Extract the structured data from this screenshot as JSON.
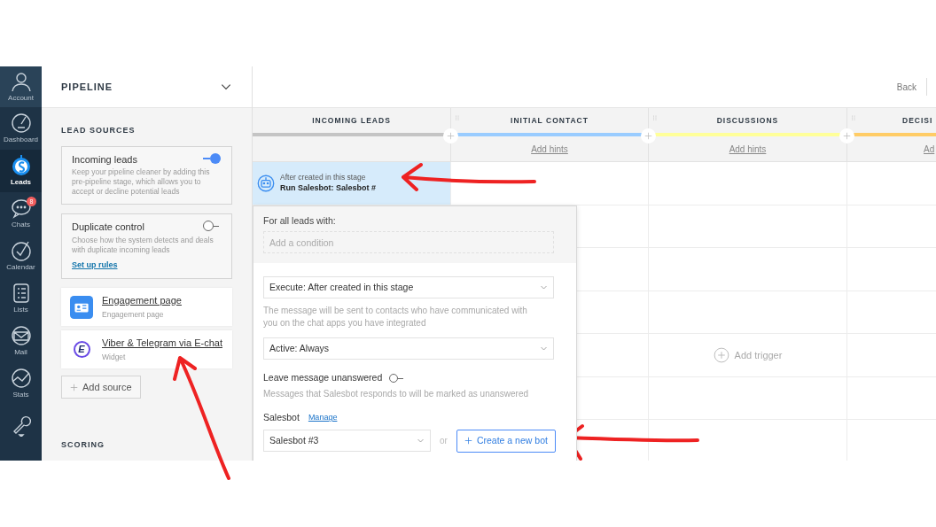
{
  "nav": [
    {
      "label": "Account",
      "selected": false
    },
    {
      "label": "Dashboard",
      "selected": false
    },
    {
      "label": "Leads",
      "selected": true
    },
    {
      "label": "Chats",
      "selected": false,
      "badge": "8"
    },
    {
      "label": "Calendar",
      "selected": false
    },
    {
      "label": "Lists",
      "selected": false
    },
    {
      "label": "Mail",
      "selected": false
    },
    {
      "label": "Stats",
      "selected": false
    },
    {
      "selected": false
    }
  ],
  "pipeline_panel": {
    "title": "PIPELINE",
    "lead_sources_heading": "LEAD SOURCES",
    "toggles": [
      {
        "title": "Incoming leads",
        "description": "Keep your pipeline cleaner by adding this pre-pipeline stage, which allows you to accept or decline potential leads",
        "on": true
      },
      {
        "title": "Duplicate control",
        "description": "Choose how the system detects and deals with duplicate incoming leads",
        "on": false,
        "link": "Set up rules"
      }
    ],
    "sources": [
      {
        "kind": "page",
        "name": "Engagement page",
        "subtitle": "Engagement page"
      },
      {
        "kind": "widget",
        "name": "Viber & Telegram via E-chat",
        "subtitle": "Widget",
        "logo_text": "E"
      }
    ],
    "add_source": "Add source",
    "scoring_heading": "SCORING"
  },
  "top_bar": {
    "back": "Back"
  },
  "stages": [
    {
      "name": "INCOMING LEADS",
      "color": "#c4c4c4"
    },
    {
      "name": "INITIAL CONTACT",
      "color": "#99ccff",
      "hint": "Add hints"
    },
    {
      "name": "DISCUSSIONS",
      "color": "#ffff99",
      "hint": "Add hints"
    },
    {
      "name": "DECISI",
      "color": "#ffcc66",
      "hint": "Ad"
    }
  ],
  "trigger_card": {
    "subtitle": "After created in this stage",
    "title": "Run Salesbot: Salesbot #"
  },
  "add_trigger": "Add trigger",
  "trigger_editor": {
    "conditions_label": "For all leads with:",
    "condition_placeholder": "Add a condition",
    "execute": "Execute: After created in this stage",
    "execute_note": "The message will be sent to contacts who have communicated with you on the chat apps you have integrated",
    "active": "Active: Always",
    "leave_unanswered": {
      "label": "Leave message unanswered",
      "on": false,
      "note": "Messages that Salesbot responds to will be marked as unanswered"
    },
    "salesbot_label": "Salesbot",
    "manage_link": "Manage",
    "salesbot_value": "Salesbot #3",
    "or": "or",
    "create_button": "Create a new bot"
  }
}
